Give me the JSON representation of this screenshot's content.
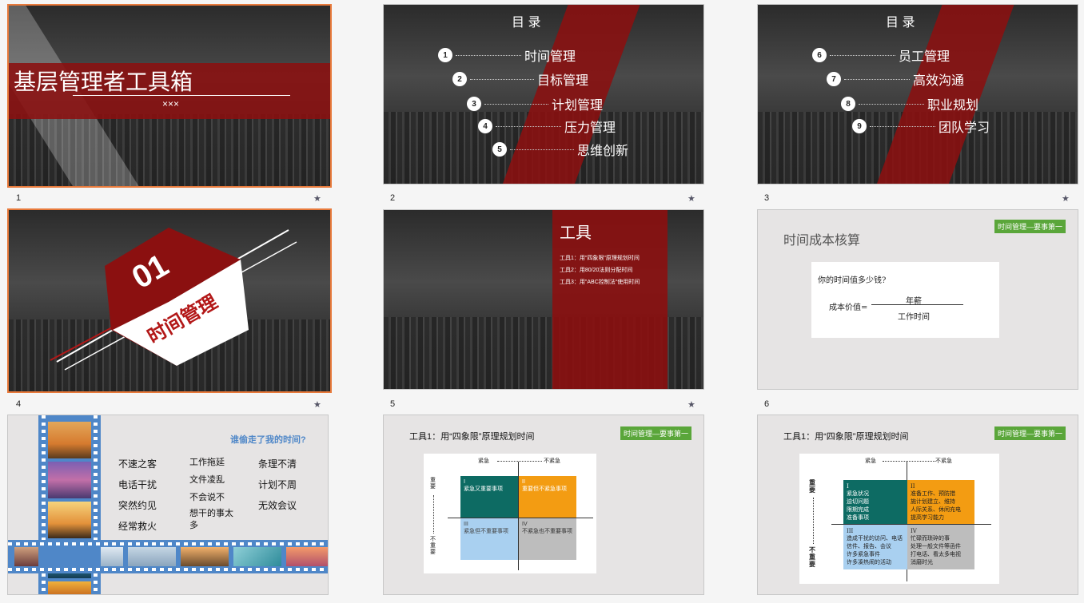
{
  "slides": [
    {
      "number": "1",
      "title": "基层管理者工具箱",
      "subtitle": "×××"
    },
    {
      "number": "2",
      "heading": "目  录",
      "items": [
        {
          "n": "1",
          "label": "时间管理"
        },
        {
          "n": "2",
          "label": "目标管理"
        },
        {
          "n": "3",
          "label": "计划管理"
        },
        {
          "n": "4",
          "label": "压力管理"
        },
        {
          "n": "5",
          "label": "思维创新"
        }
      ]
    },
    {
      "number": "3",
      "heading": "目  录",
      "items": [
        {
          "n": "6",
          "label": "员工管理"
        },
        {
          "n": "7",
          "label": "高效沟通"
        },
        {
          "n": "8",
          "label": "职业规划"
        },
        {
          "n": "9",
          "label": "团队学习"
        }
      ]
    },
    {
      "number": "4",
      "big": "01",
      "section": "时间管理"
    },
    {
      "number": "5",
      "heading": "工具",
      "lines": [
        "工具1：用\"四象限\"原理规划时间",
        "工具2：用80/20法则分配时间",
        "工具3：用\"ABC控制法\"使用时间"
      ]
    },
    {
      "number": "6",
      "title": "时间成本核算",
      "tag": "时间管理—要事第一",
      "question": "你的时间值多少钱?",
      "formula_left": "成本价值=",
      "numerator": "年薪",
      "denominator": "工作时间"
    },
    {
      "number": "7",
      "question": "谁偷走了我的时间?",
      "words": [
        "不速之客",
        "电话干扰",
        "突然约见",
        "经常救火",
        "工作拖延",
        "文件凌乱",
        "不会说不",
        "想干的事太多",
        "条理不清",
        "计划不周",
        "无效会议"
      ]
    },
    {
      "number": "8",
      "title": "工具1：用“四象限”原理规划时间",
      "tag": "时间管理—要事第一",
      "axis_x_left": "紧急",
      "axis_x_right": "不紧急",
      "axis_y_top": "重要",
      "axis_y_bottom": "不重要",
      "q1": "I\n紧急又重要事项",
      "q2": "II\n重要但不紧急事项",
      "q3": "III\n紧急但不重要事项",
      "q4": "IV\n不紧急也不重要事项"
    },
    {
      "number": "9",
      "title": "工具1：用“四象限”原理规划时间",
      "tag": "时间管理—要事第一",
      "axis_x_left": "紧急",
      "axis_x_right": "不紧急",
      "axis_y_top": "重要",
      "axis_y_bottom": "不重要",
      "q1": "I\n紧急状况\n迫切问题\n限期完成\n准备事项",
      "q2": "II\n准备工作、预防措\n施计划建立、维持\n人际关系、休闲充电\n提高学习能力",
      "q3": "III\n造成干扰的访问、电话\n信件、报告、会议\n许多紧急事件\n许多凑热闹的活动",
      "q4": "IV\n忙碌而琐碎的事\n处理一般文件等函件\n打电话、看太多电视\n消磨时光"
    }
  ],
  "colors": {
    "accent": "#8b1010",
    "selected": "#e87a3b",
    "tag": "#5aa63a"
  }
}
